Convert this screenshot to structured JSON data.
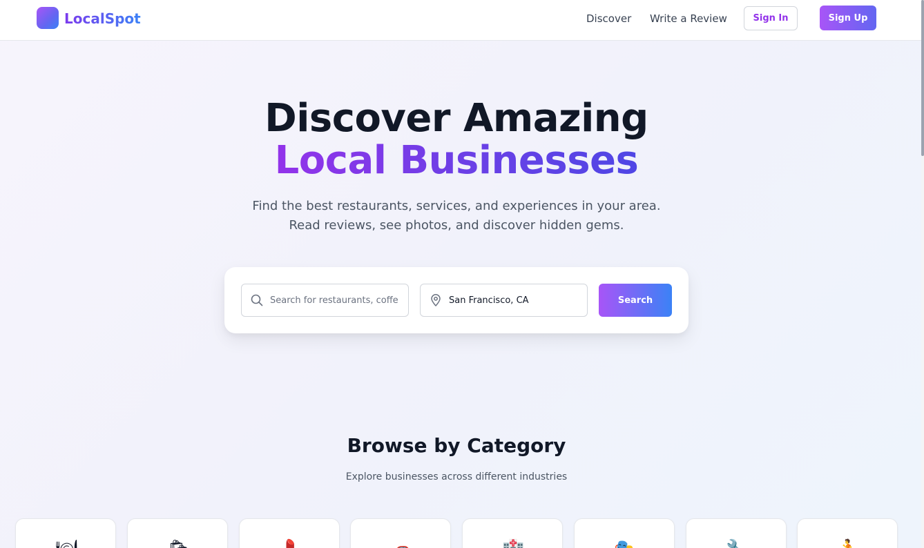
{
  "header": {
    "brand": "LocalSpot",
    "nav": {
      "discover": "Discover",
      "write_review": "Write a Review"
    },
    "sign_in": "Sign In",
    "sign_up": "Sign Up"
  },
  "hero": {
    "title_line1": "Discover Amazing",
    "title_line2": "Local Businesses",
    "subtitle": "Find the best restaurants, services, and experiences in your area. Read reviews, see photos, and discover hidden gems."
  },
  "search": {
    "query_placeholder": "Search for restaurants, coffee, bars...",
    "query_value": "",
    "location_value": "San Francisco, CA",
    "button_label": "Search"
  },
  "categories": {
    "title": "Browse by Category",
    "subtitle": "Explore businesses across different industries",
    "items": [
      {
        "icon": "restaurant-icon",
        "glyph": "🍽"
      },
      {
        "icon": "shopping-icon",
        "glyph": "🛍"
      },
      {
        "icon": "beauty-icon",
        "glyph": "💄"
      },
      {
        "icon": "automotive-icon",
        "glyph": "🚗"
      },
      {
        "icon": "health-icon",
        "glyph": "🏥"
      },
      {
        "icon": "arts-icon",
        "glyph": "🎭"
      },
      {
        "icon": "home-services-icon",
        "glyph": "🔧"
      },
      {
        "icon": "fitness-icon",
        "glyph": "🏃"
      }
    ]
  },
  "colors": {
    "brand_purple": "#9333ea",
    "brand_blue": "#3b82f6",
    "heading": "#111827"
  }
}
